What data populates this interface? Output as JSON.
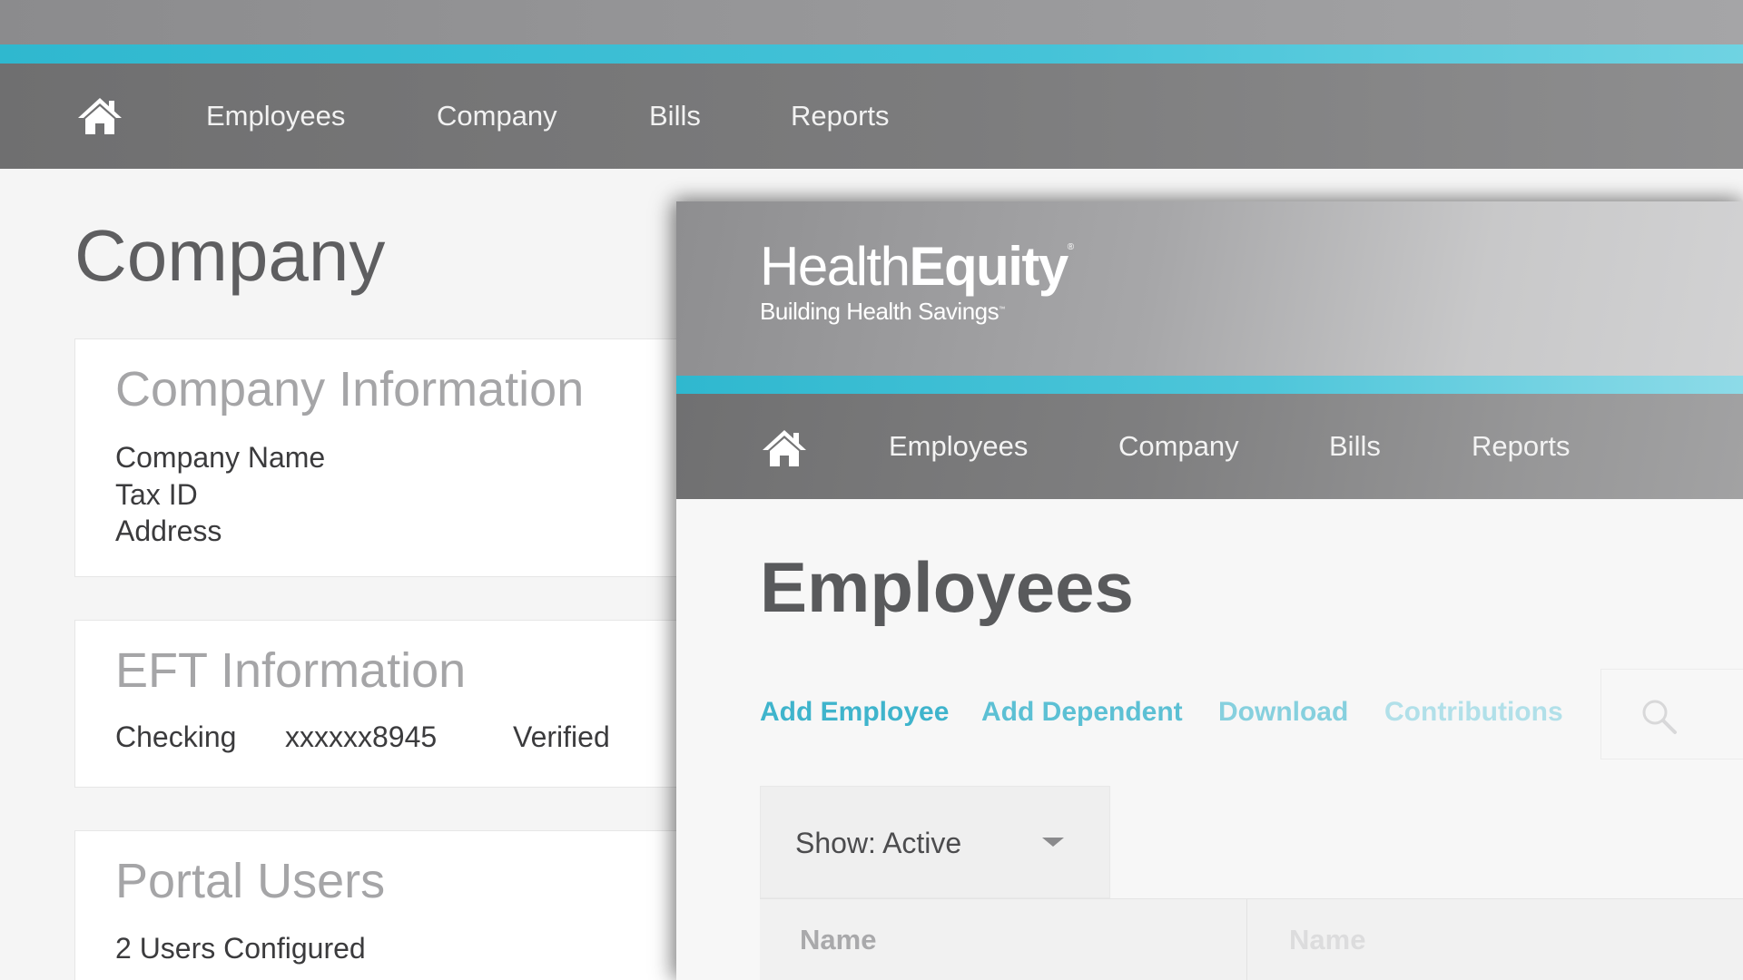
{
  "back_window": {
    "nav": {
      "home_icon": "home-icon",
      "items": [
        "Employees",
        "Company",
        "Bills",
        "Reports"
      ]
    },
    "page_title": "Company",
    "company_info": {
      "title": "Company Information",
      "lines": [
        "Company Name",
        "Tax ID",
        "Address"
      ]
    },
    "eft_info": {
      "title": "EFT Information",
      "account_type": "Checking",
      "account_number": "xxxxxx8945",
      "status": "Verified"
    },
    "portal_users": {
      "title": "Portal Users",
      "summary": "2 Users Configured"
    }
  },
  "front_window": {
    "logo": {
      "word_light": "Health",
      "word_bold": "Equity",
      "tagline": "Building Health Savings"
    },
    "nav": {
      "home_icon": "home-icon",
      "items": [
        "Employees",
        "Company",
        "Bills",
        "Reports"
      ]
    },
    "page_title": "Employees",
    "actions": [
      {
        "label": "Add Employee",
        "color": "#3fb4cc"
      },
      {
        "label": "Add Dependent",
        "color": "#5cc0d4"
      },
      {
        "label": "Download",
        "color": "#86d0de"
      },
      {
        "label": "Contributions",
        "color": "#b1e0e9"
      }
    ],
    "search_icon": "search-icon",
    "filter": {
      "label": "Show: Active"
    },
    "table": {
      "headers": [
        {
          "label": "Name",
          "color": "#a9a9ab"
        },
        {
          "label": "Name",
          "color": "#dcdcdd"
        }
      ]
    }
  },
  "colors": {
    "accent": "#3fb4cc",
    "nav_bg": "#7a7a7b",
    "header_bg": "#a7a7a9"
  }
}
